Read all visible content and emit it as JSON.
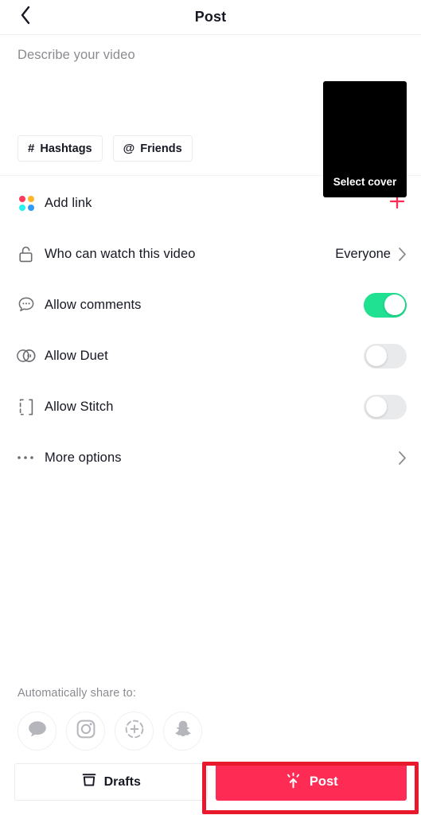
{
  "header": {
    "title": "Post",
    "back_icon": "chevron-left-icon"
  },
  "describe": {
    "placeholder": "Describe your video",
    "value": "",
    "chips": [
      {
        "glyph": "#",
        "label": "Hashtags",
        "icon": "hashtag-icon"
      },
      {
        "glyph": "@",
        "label": "Friends",
        "icon": "at-mention-icon"
      }
    ],
    "cover": {
      "label": "Select cover",
      "background": "#000000"
    }
  },
  "options": [
    {
      "id": "add-link",
      "label": "Add link",
      "icon": "dot-grid-icon",
      "control": "plus",
      "accent": "#fe2c55"
    },
    {
      "id": "who-can-watch",
      "label": "Who can watch this video",
      "icon": "unlocked-padlock-icon",
      "control": "value-chevron",
      "value": "Everyone"
    },
    {
      "id": "allow-comments",
      "label": "Allow comments",
      "icon": "comment-bubble-icon",
      "control": "toggle",
      "toggle_on": true,
      "on_color": "#20e092"
    },
    {
      "id": "allow-duet",
      "label": "Allow Duet",
      "icon": "duet-circles-icon",
      "control": "toggle",
      "toggle_on": false,
      "off_color": "#e9eaec"
    },
    {
      "id": "allow-stitch",
      "label": "Allow Stitch",
      "icon": "stitch-frame-icon",
      "control": "toggle",
      "toggle_on": false,
      "off_color": "#e9eaec"
    },
    {
      "id": "more-options",
      "label": "More options",
      "icon": "ellipsis-icon",
      "control": "chevron"
    }
  ],
  "share": {
    "title": "Automatically share to:",
    "targets": [
      {
        "id": "messages",
        "icon": "speech-bubble-icon"
      },
      {
        "id": "instagram",
        "icon": "instagram-camera-icon"
      },
      {
        "id": "instagram-story",
        "icon": "instagram-story-plus-icon"
      },
      {
        "id": "snapchat",
        "icon": "snapchat-ghost-icon"
      }
    ]
  },
  "footer": {
    "drafts": {
      "label": "Drafts",
      "icon": "archive-box-icon"
    },
    "post": {
      "label": "Post",
      "icon": "upload-burst-icon",
      "color": "#fe2c55"
    }
  },
  "annotation": {
    "highlight_color": "#e8192c",
    "target": "post-button"
  }
}
